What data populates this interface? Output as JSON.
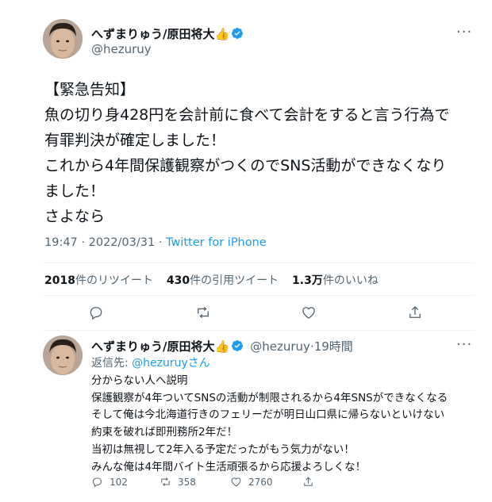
{
  "main_tweet": {
    "display_name": "へずまりゅう/原田将大",
    "emoji": "👍",
    "handle": "@hezuruy",
    "body_lines": [
      "【緊急告知】",
      "魚の切り身428円を会計前に食べて会計をすると言う行為で",
      "有罪判決が確定しました！",
      "これから4年間保護観察がつくのでSNS活動ができなくなり",
      "ました！",
      "さよなら"
    ],
    "time": "19:47",
    "date": "2022/03/31",
    "separator": "·",
    "app": "Twitter for iPhone",
    "retweets_count": "2018",
    "retweets_label": "件のリツイート",
    "quotes_count": "430",
    "quotes_label": "件の引用ツイート",
    "likes_count": "1.3万",
    "likes_label": "件のいいね"
  },
  "reply_tweet": {
    "display_name": "へずまりゅう/原田将大",
    "emoji": "👍",
    "handle": "@hezuruy",
    "separator": "·",
    "time_ago": "19時間",
    "reply_prefix": "返信先: ",
    "reply_to": "@hezuruyさん",
    "body_lines": [
      "分からない人へ説明",
      "保護観察が4年ついてSNSの活動が制限されるから4年SNSができなくなる",
      "そして俺は今北海道行きのフェリーだが明日山口県に帰らないといけない",
      "約束を破れば即刑務所2年だ！",
      "当初は無視して2年入る予定だったがもう気力がない！",
      "みんな俺は4年間バイト生活頑張るから応援よろしくな！"
    ],
    "reply_count": "102",
    "retweet_count": "358",
    "like_count": "2760"
  },
  "colors": {
    "text": "#0f1419",
    "secondary": "#536471",
    "link": "#1d9bf0",
    "verified": "#1d9bf0",
    "divider": "#eff3f4"
  },
  "icons": [
    "more-icon",
    "verified-badge-icon",
    "reply-icon",
    "retweet-icon",
    "like-icon",
    "share-icon"
  ]
}
